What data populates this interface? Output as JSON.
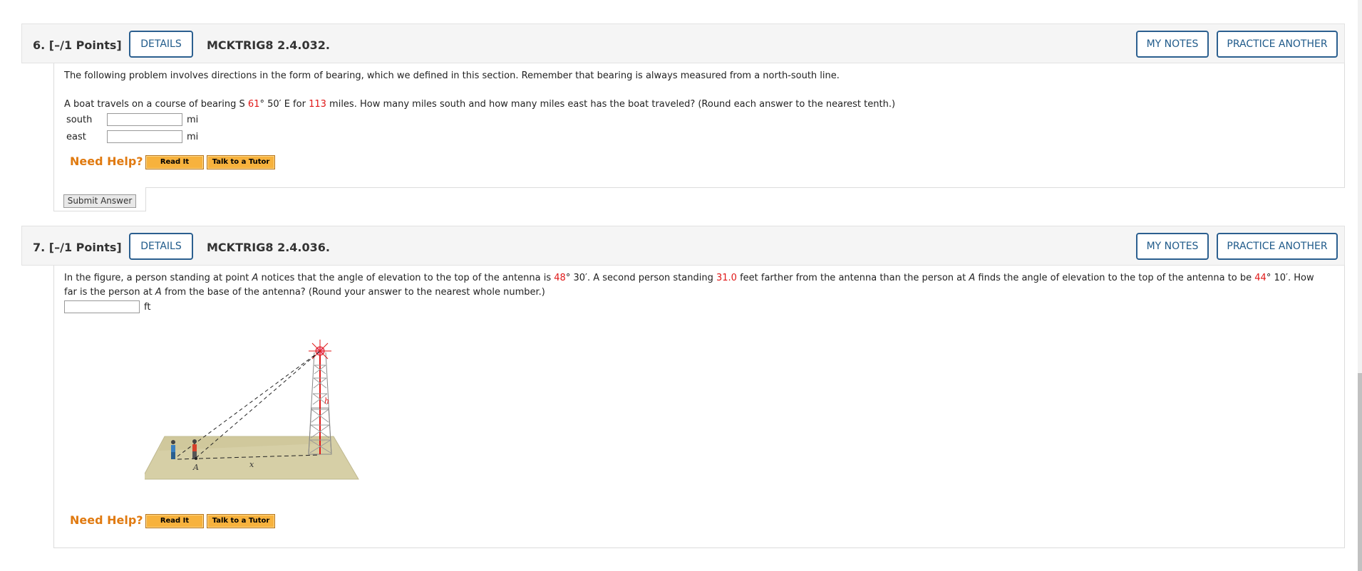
{
  "q6": {
    "number": "6.",
    "points": "[–/1 Points]",
    "details": "DETAILS",
    "code": "MCKTRIG8 2.4.032.",
    "my_notes": "MY NOTES",
    "practice": "PRACTICE ANOTHER",
    "intro": "The following problem involves directions in the form of bearing, which we defined in this section. Remember that bearing is always measured from a north-south line.",
    "problem": {
      "p1": "A boat travels on a course of bearing S ",
      "v1": "61",
      "p2": "° 50′ E for ",
      "v2": "113",
      "p3": " miles. How many miles south and how many miles east has the boat traveled? (Round each answer to the nearest tenth.)"
    },
    "south_label": "south",
    "east_label": "east",
    "unit": "mi",
    "south_value": "",
    "east_value": "",
    "need_help": "Need Help?",
    "read_it": "Read It",
    "talk_tutor": "Talk to a Tutor",
    "submit": "Submit Answer"
  },
  "q7": {
    "number": "7.",
    "points": "[–/1 Points]",
    "details": "DETAILS",
    "code": "MCKTRIG8 2.4.036.",
    "my_notes": "MY NOTES",
    "practice": "PRACTICE ANOTHER",
    "line1": {
      "p1": "In the figure, a person standing at point ",
      "a1": "A",
      "p2": " notices that the angle of elevation to the top of the antenna is ",
      "v1": "48",
      "p3": "° 30′. A second person standing ",
      "v2": "31.0",
      "p4": " feet farther from the antenna than the person at ",
      "a2": "A",
      "p5": " finds the angle of elevation to the top of the antenna to be ",
      "v3": "44",
      "p6": "° 10′. How"
    },
    "line2": {
      "p1": "far is the person at ",
      "a1": "A",
      "p2": " from the base of the antenna? (Round your answer to the nearest whole number.)"
    },
    "unit": "ft",
    "answer_value": "",
    "figure": {
      "label_h": "h",
      "label_a": "A",
      "label_x": "x"
    },
    "need_help": "Need Help?",
    "read_it": "Read It",
    "talk_tutor": "Talk to a Tutor"
  },
  "colors": {
    "accent_blue": "#2b5f8f",
    "help_orange": "#e07a10",
    "value_red": "#e01818"
  }
}
